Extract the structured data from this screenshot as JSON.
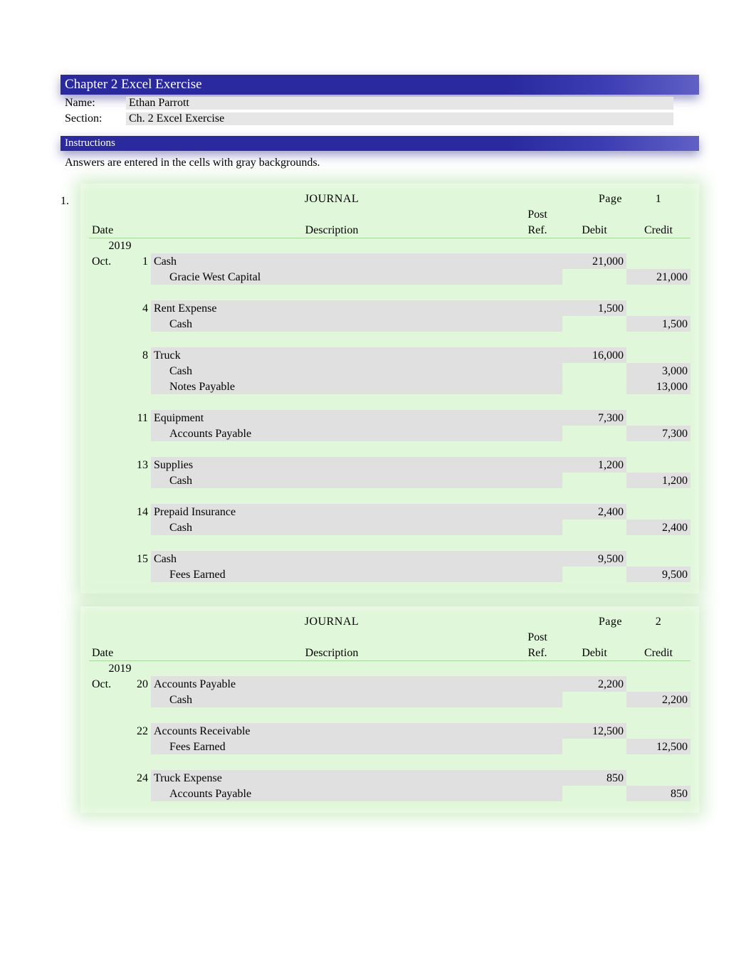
{
  "header": {
    "title": "Chapter 2 Excel Exercise",
    "name_label": "Name:",
    "name_value": "Ethan Parrott",
    "section_label": "Section:",
    "section_value": "Ch. 2 Excel Exercise",
    "instructions_label": "Instructions",
    "instructions_text": "Answers are entered in the cells with gray backgrounds."
  },
  "problem_number": "1.",
  "journal_label": "JOURNAL",
  "page_label": "Page",
  "columns": {
    "date": "Date",
    "description": "Description",
    "post_ref_top": "Post",
    "post_ref_bottom": "Ref.",
    "debit": "Debit",
    "credit": "Credit"
  },
  "journals": [
    {
      "page": "1",
      "year": "2019",
      "month": "Oct.",
      "entries": [
        {
          "day": "1",
          "lines": [
            {
              "desc": "Cash",
              "indent": false,
              "postref_gray": true,
              "debit": "21,000",
              "credit": ""
            },
            {
              "desc": "Gracie West Capital",
              "indent": true,
              "postref_gray": true,
              "debit": "",
              "credit": "21,000"
            }
          ]
        },
        {
          "day": "4",
          "lines": [
            {
              "desc": "Rent Expense",
              "indent": false,
              "postref_gray": true,
              "debit": "1,500",
              "credit": ""
            },
            {
              "desc": "Cash",
              "indent": true,
              "postref_gray": true,
              "debit": "",
              "credit": "1,500"
            }
          ]
        },
        {
          "day": "8",
          "lines": [
            {
              "desc": "Truck",
              "indent": false,
              "postref_gray": true,
              "debit": "16,000",
              "credit": ""
            },
            {
              "desc": "Cash",
              "indent": true,
              "postref_gray": true,
              "debit": "",
              "credit": "3,000"
            },
            {
              "desc": "Notes Payable",
              "indent": true,
              "postref_gray": true,
              "debit": "",
              "credit": "13,000"
            }
          ]
        },
        {
          "day": "11",
          "lines": [
            {
              "desc": "Equipment",
              "indent": false,
              "postref_gray": true,
              "debit": "7,300",
              "credit": ""
            },
            {
              "desc": "Accounts Payable",
              "indent": true,
              "postref_gray": true,
              "debit": "",
              "credit": "7,300"
            }
          ]
        },
        {
          "day": "13",
          "lines": [
            {
              "desc": "Supplies",
              "indent": false,
              "postref_gray": true,
              "debit": "1,200",
              "credit": ""
            },
            {
              "desc": "Cash",
              "indent": true,
              "postref_gray": true,
              "debit": "",
              "credit": "1,200"
            }
          ]
        },
        {
          "day": "14",
          "lines": [
            {
              "desc": "Prepaid Insurance",
              "indent": false,
              "postref_gray": true,
              "debit": "2,400",
              "credit": ""
            },
            {
              "desc": "Cash",
              "indent": true,
              "postref_gray": true,
              "debit": "",
              "credit": "2,400"
            }
          ]
        },
        {
          "day": "15",
          "lines": [
            {
              "desc": "Cash",
              "indent": false,
              "postref_gray": true,
              "debit": "9,500",
              "credit": ""
            },
            {
              "desc": "Fees Earned",
              "indent": true,
              "postref_gray": true,
              "debit": "",
              "credit": "9,500"
            }
          ]
        }
      ]
    },
    {
      "page": "2",
      "year": "2019",
      "month": "Oct.",
      "entries": [
        {
          "day": "20",
          "lines": [
            {
              "desc": "Accounts Payable",
              "indent": false,
              "postref_gray": true,
              "debit": "2,200",
              "credit": ""
            },
            {
              "desc": "Cash",
              "indent": true,
              "postref_gray": true,
              "debit": "",
              "credit": "2,200"
            }
          ]
        },
        {
          "day": "22",
          "lines": [
            {
              "desc": "Accounts Receivable",
              "indent": false,
              "postref_gray": true,
              "debit": "12,500",
              "credit": ""
            },
            {
              "desc": "Fees Earned",
              "indent": true,
              "postref_gray": true,
              "debit": "",
              "credit": "12,500"
            }
          ]
        },
        {
          "day": "24",
          "lines": [
            {
              "desc": "Truck Expense",
              "indent": false,
              "postref_gray": true,
              "debit": "850",
              "credit": ""
            },
            {
              "desc": "Accounts Payable",
              "indent": true,
              "postref_gray": true,
              "debit": "",
              "credit": "850"
            }
          ]
        }
      ]
    }
  ]
}
